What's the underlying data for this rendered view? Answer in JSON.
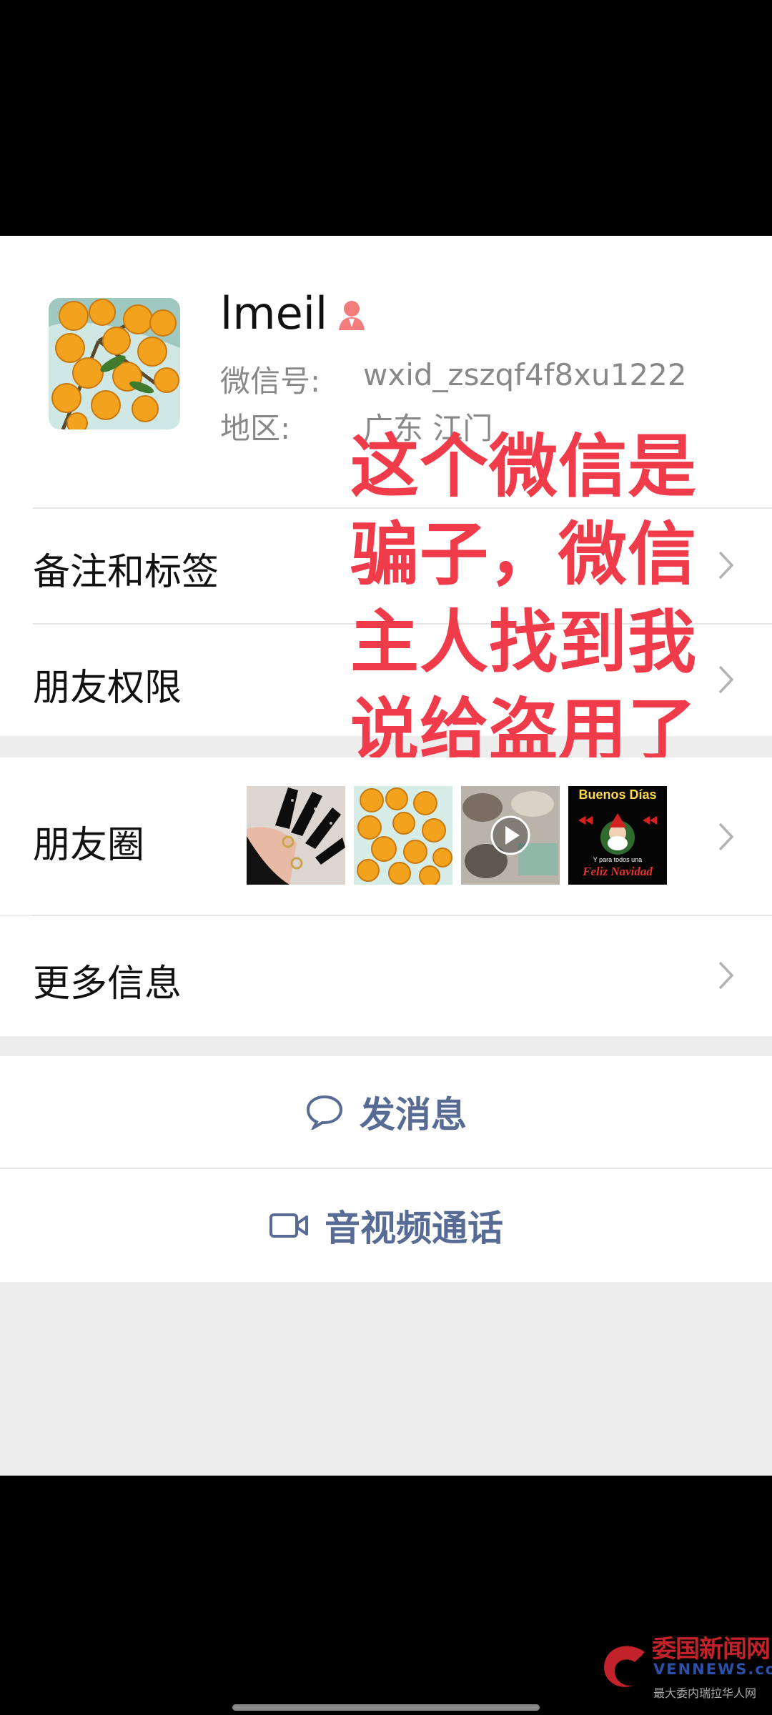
{
  "profile": {
    "name": "lmeil",
    "wechat_id_label": "微信号:",
    "wechat_id_value": "wxid_zszqf4f8xu1222",
    "region_label": "地区:",
    "region_value": "广东 江门"
  },
  "overlay_note": {
    "line1": "这个微信是",
    "line2": "骗子，微信",
    "line3": "主人找到我",
    "line4": "说给盗用了"
  },
  "menu": {
    "remarks_label": "备注和标签",
    "permissions_label": "朋友权限",
    "moments_label": "朋友圈",
    "more_info_label": "更多信息"
  },
  "moments_thumbs": {
    "christmas_top": "Buenos Días",
    "christmas_mid": "Y para todos una",
    "christmas_bottom": "Feliz Navidad"
  },
  "actions": {
    "message_label": "发消息",
    "call_label": "音视频通话"
  },
  "watermark": {
    "title": "委国新闻网",
    "sub": "VENNEWS.com",
    "tagline": "最大委内瑞拉华人网"
  },
  "colors": {
    "link_blue": "#576b95",
    "overlay_red": "#ef3b4a",
    "gender_pink": "#f37b7b",
    "background_gray": "#ededed"
  }
}
